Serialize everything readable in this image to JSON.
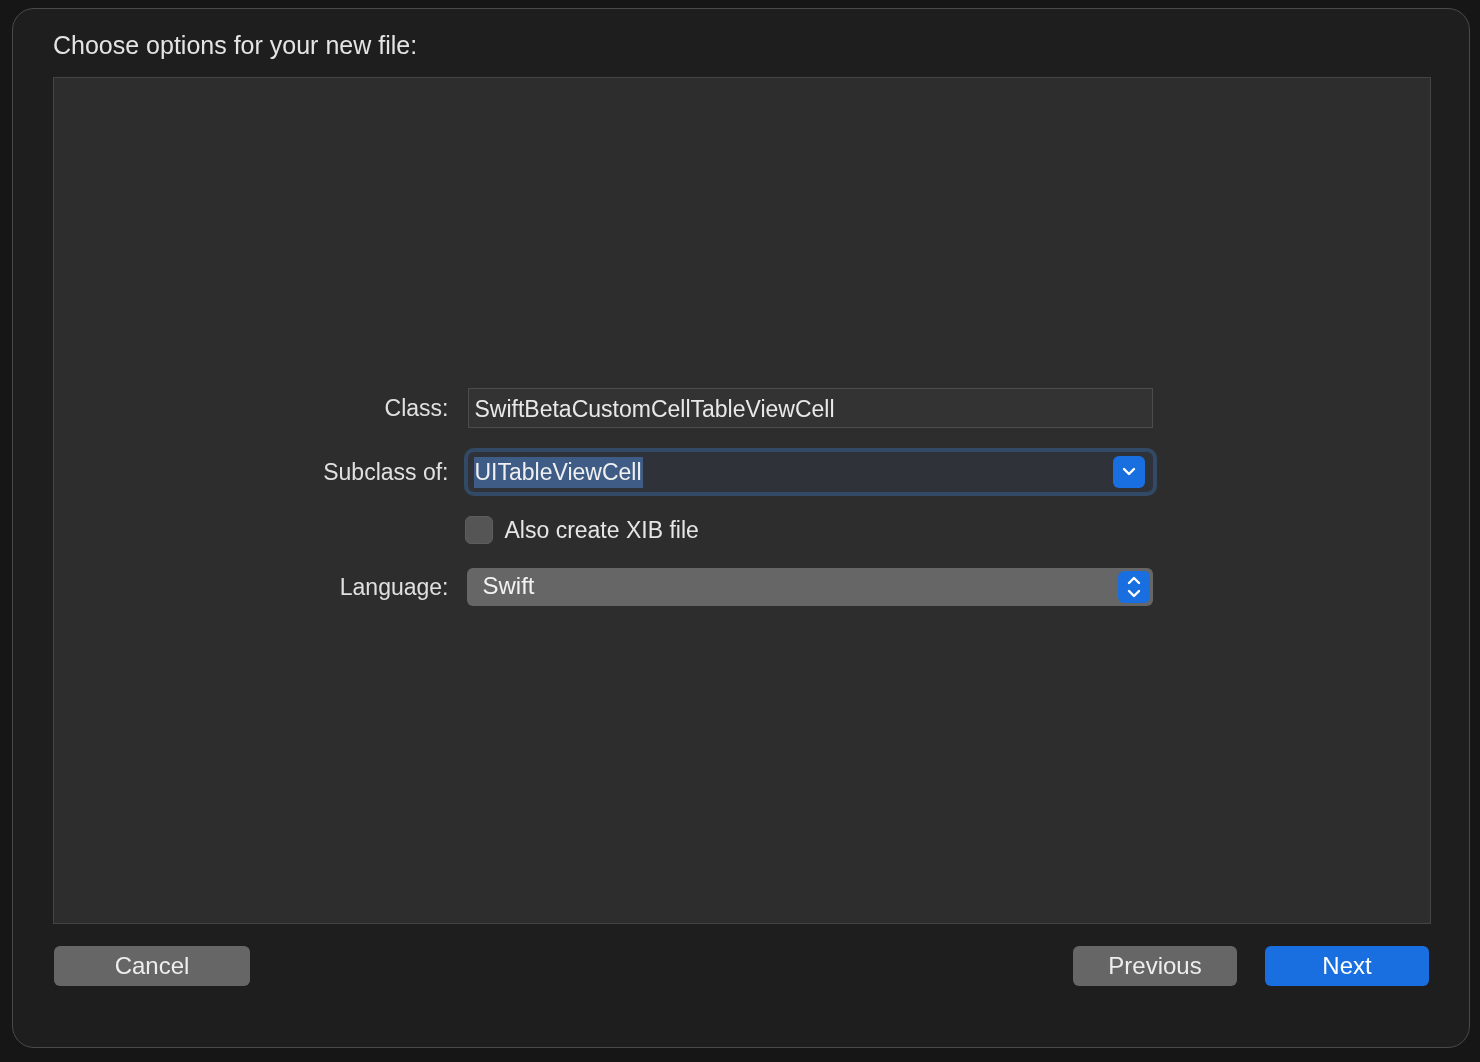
{
  "dialog": {
    "title": "Choose options for your new file:"
  },
  "fields": [
    {
      "kind": "text",
      "label": "Class:",
      "value": "SwiftBetaCustomCellTableViewCell"
    },
    {
      "kind": "combo",
      "label": "Subclass of:",
      "value": "UITableViewCell",
      "focused": true,
      "text_selected": true
    },
    {
      "kind": "checkbox",
      "label": "Also create XIB file",
      "checked": false
    },
    {
      "kind": "popup",
      "label": "Language:",
      "value": "Swift"
    }
  ],
  "buttons": [
    {
      "label": "Cancel",
      "default": false
    },
    {
      "label": "Previous",
      "default": false
    },
    {
      "label": "Next",
      "default": true
    }
  ]
}
